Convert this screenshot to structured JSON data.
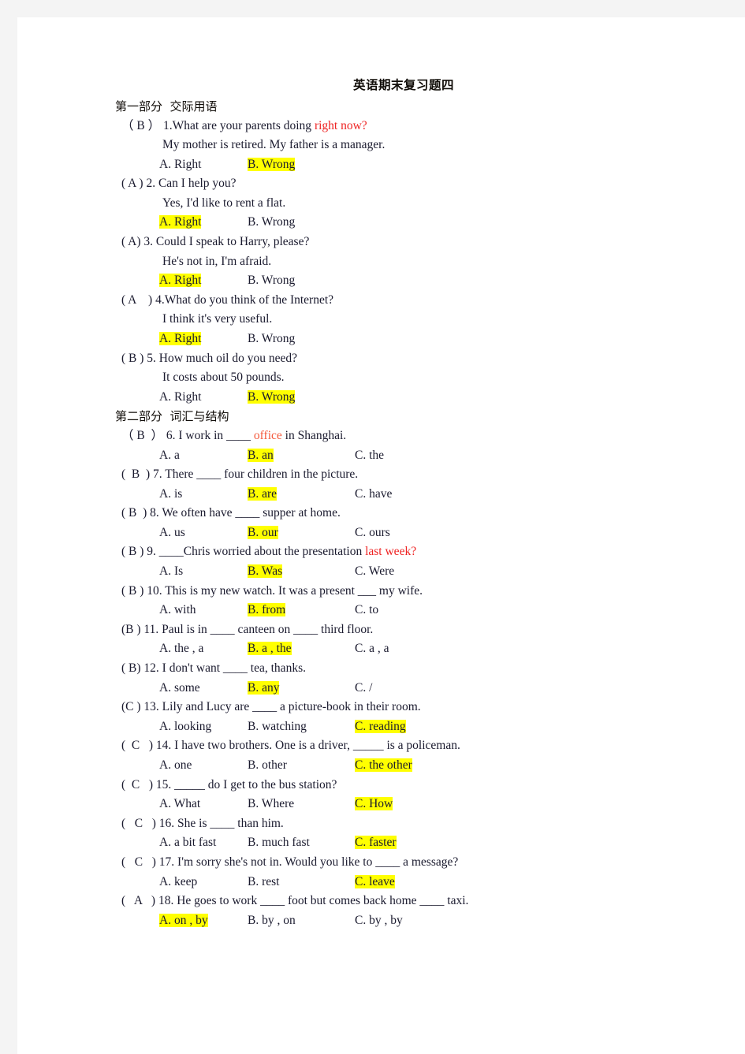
{
  "document": {
    "title": "英语期末复习题四",
    "background_color": "#f4f4f4",
    "page_color": "#ffffff",
    "highlight_color": "#ffff00",
    "accent_red": "#ee2222"
  },
  "sections": [
    {
      "heading": "第一部分  交际用语",
      "items": [
        {
          "marker": "（ B ）",
          "number": "1.",
          "stem_plain": "What are your parents doing ",
          "stem_red": "right now?",
          "reply": "My mother is retired. My father is a manager.",
          "options": [
            {
              "label": "A. Right",
              "highlight": false
            },
            {
              "label": "B. Wrong",
              "highlight": true
            }
          ]
        },
        {
          "marker": "( A )",
          "number": "2.",
          "stem_plain": " Can I help you?",
          "stem_red": "",
          "reply": "Yes, I'd like to rent a flat.",
          "options": [
            {
              "label": "A. Right",
              "highlight": true
            },
            {
              "label": "B. Wrong",
              "highlight": false
            }
          ]
        },
        {
          "marker": "( A)",
          "number": "3.",
          "stem_plain": " Could I speak to Harry, please?",
          "stem_red": "",
          "reply": "He's not in, I'm afraid.",
          "options": [
            {
              "label": "A. Right",
              "highlight": true
            },
            {
              "label": "B. Wrong",
              "highlight": false
            }
          ]
        },
        {
          "marker": "( A    )",
          "number": "4.",
          "stem_plain": "What do you think of the Internet?",
          "stem_red": "",
          "reply": "I think it's very useful.",
          "options": [
            {
              "label": "A. Right",
              "highlight": true
            },
            {
              "label": "B. Wrong",
              "highlight": false
            }
          ]
        },
        {
          "marker": "( B )",
          "number": "5.",
          "stem_plain": " How much oil do you need?",
          "stem_red": "",
          "reply": "It costs about 50 pounds.",
          "options": [
            {
              "label": "A. Right",
              "highlight": false
            },
            {
              "label": "B. Wrong",
              "highlight": true
            }
          ]
        }
      ]
    },
    {
      "heading": "第二部分  词汇与结构",
      "items": [
        {
          "marker": "（ B  ）",
          "number": "6.",
          "stem_plain": " I work in ____ ",
          "stem_red": "office",
          "stem_tail": " in Shanghai.",
          "options": [
            {
              "label": "A. a",
              "highlight": false
            },
            {
              "label": "B. an",
              "highlight": true
            },
            {
              "label": "C. the",
              "highlight": false
            }
          ]
        },
        {
          "marker": "(  B  )",
          "number": "7.",
          "stem_plain": " There ____ four children in the picture.",
          "options": [
            {
              "label": "A. is",
              "highlight": false
            },
            {
              "label": "B. are",
              "highlight": true
            },
            {
              "label": "C. have",
              "highlight": false
            }
          ]
        },
        {
          "marker": "( B  )",
          "number": "8.",
          "stem_plain": " We often have ____ supper at home.",
          "options": [
            {
              "label": "A. us",
              "highlight": false
            },
            {
              "label": "B. our",
              "highlight": true
            },
            {
              "label": "C. ours",
              "highlight": false
            }
          ]
        },
        {
          "marker": "( B )",
          "number": "9.",
          "stem_plain": " ____Chris worried about the presentation ",
          "stem_red": "last week?",
          "options": [
            {
              "label": "A. Is",
              "highlight": false
            },
            {
              "label": "B. Was",
              "highlight": true
            },
            {
              "label": "C. Were",
              "highlight": false
            }
          ]
        },
        {
          "marker": "( B )",
          "number": "10.",
          "stem_plain": " This is my new watch. It was a present ___ my wife.",
          "options": [
            {
              "label": "A. with",
              "highlight": false
            },
            {
              "label": "B. from",
              "highlight": true
            },
            {
              "label": "C. to",
              "highlight": false
            }
          ]
        },
        {
          "marker": "(B )",
          "number": "11.",
          "stem_plain": " Paul is in ____ canteen on ____ third floor.",
          "options": [
            {
              "label": "A. the , a",
              "highlight": false
            },
            {
              "label": "B. a , the",
              "highlight": true
            },
            {
              "label": "C. a , a",
              "highlight": false
            }
          ]
        },
        {
          "marker": "( B)",
          "number": "12.",
          "stem_plain": " I don't want ____ tea, thanks.",
          "options": [
            {
              "label": "A. some",
              "highlight": false
            },
            {
              "label": "B. any",
              "highlight": true
            },
            {
              "label": "C. /",
              "highlight": false
            }
          ]
        },
        {
          "marker": "(C )",
          "number": "13.",
          "stem_plain": " Lily and Lucy are ____ a picture-book in their room.",
          "options": [
            {
              "label": "A. looking",
              "highlight": false
            },
            {
              "label": "B. watching",
              "highlight": false
            },
            {
              "label": "C. reading",
              "highlight": true
            }
          ]
        },
        {
          "marker": "(  C   )",
          "number": "14.",
          "stem_plain": " I have two brothers. One is a driver, _____ is a policeman.",
          "options": [
            {
              "label": "A. one",
              "highlight": false
            },
            {
              "label": "B. other",
              "highlight": false
            },
            {
              "label": "C. the other",
              "highlight": true
            }
          ]
        },
        {
          "marker": "(  C   )",
          "number": "15.",
          "stem_plain": " _____ do I get to the bus station?",
          "options": [
            {
              "label": "A. What",
              "highlight": false
            },
            {
              "label": "B. Where",
              "highlight": false
            },
            {
              "label": "C. How",
              "highlight": true
            }
          ]
        },
        {
          "marker": "(   C   )",
          "number": "16.",
          "stem_plain": " She is ____ than him.",
          "options": [
            {
              "label": "A. a bit fast",
              "highlight": false
            },
            {
              "label": "B. much fast",
              "highlight": false
            },
            {
              "label": "C. faster",
              "highlight": true
            }
          ]
        },
        {
          "marker": "(   C   )",
          "number": "17.",
          "stem_plain": " I'm sorry she's not in. Would you like to ____ a message?",
          "options": [
            {
              "label": "A. keep",
              "highlight": false
            },
            {
              "label": "B. rest",
              "highlight": false
            },
            {
              "label": "C. leave",
              "highlight": true
            }
          ]
        },
        {
          "marker": "(   A   )",
          "number": "18.",
          "stem_plain": " He goes to work ____ foot but comes back home ____ taxi.",
          "options": [
            {
              "label": "A. on , by",
              "highlight": true
            },
            {
              "label": "B. by , on",
              "highlight": false
            },
            {
              "label": "C. by , by",
              "highlight": false
            }
          ]
        }
      ]
    }
  ]
}
